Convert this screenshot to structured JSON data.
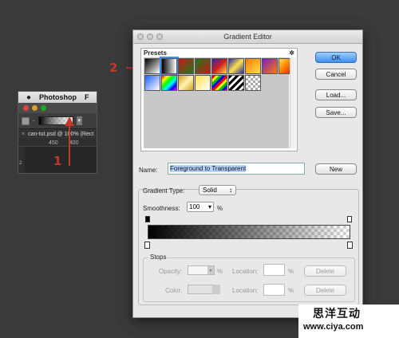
{
  "photoshop": {
    "apple": "",
    "app_name": "Photoshop",
    "next_menu": "F",
    "options_dash": "-",
    "doc_tab_close": "×",
    "doc_tab": "can-tut.psd @ 100% (Rect",
    "ruler_labels": [
      "450",
      "400"
    ],
    "vruler_label": "2"
  },
  "annotations": {
    "one": "1",
    "two": "2"
  },
  "dialog": {
    "title": "Gradient Editor",
    "presets_label": "Presets",
    "presets_gear": "✲",
    "buttons": {
      "ok": "OK",
      "cancel": "Cancel",
      "load": "Load...",
      "save": "Save...",
      "new": "New"
    },
    "name_label": "Name:",
    "name_value": "Foreground to Transparent",
    "gradient_type_label": "Gradient Type:",
    "gradient_type_value": "Solid",
    "smoothness_label": "Smoothness:",
    "smoothness_value": "100",
    "smoothness_unit": "%",
    "stops": {
      "label": "Stops",
      "opacity_label": "Opacity:",
      "opacity_unit": "%",
      "location_label": "Location:",
      "location_unit": "%",
      "delete": "Delete",
      "color_label": "Color:"
    }
  },
  "watermark": {
    "line1": "思洋互动",
    "url": "www.ciya.com"
  },
  "preset_swatch_colors": [
    "checker-bw",
    "bw",
    "red-green",
    "green-red",
    "blue-red-yellow",
    "blue-yellow-blue",
    "orange-yellow",
    "violet-orange",
    "yellow-orange",
    "blue-white",
    "rainbow",
    "metal",
    "yellow-white",
    "rainbow-stripe",
    "bw-stripe",
    "checker-gray"
  ],
  "accent_color": "#3d8ef0"
}
